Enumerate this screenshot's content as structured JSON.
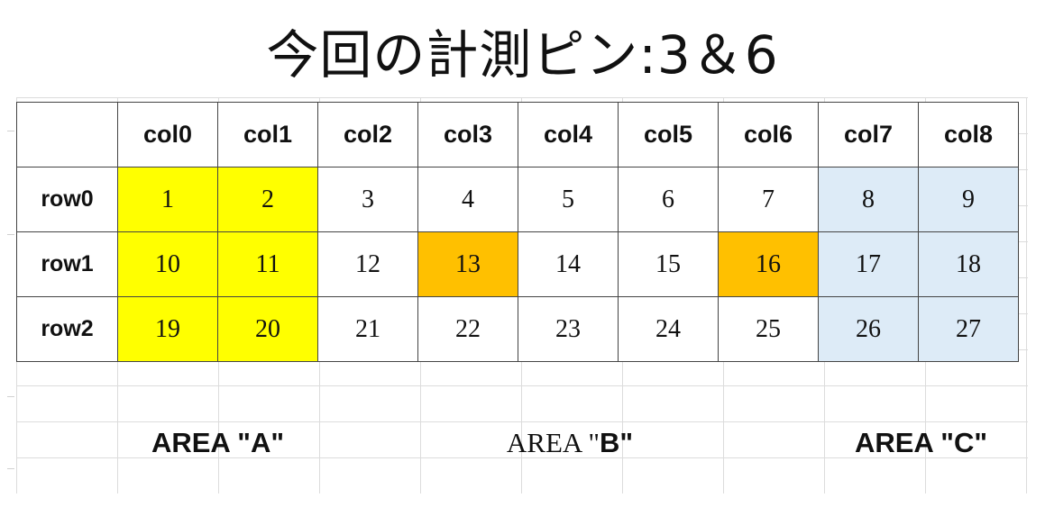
{
  "title": "今回の計測ピン:3＆6",
  "columns": [
    "col0",
    "col1",
    "col2",
    "col3",
    "col4",
    "col5",
    "col6",
    "col7",
    "col8"
  ],
  "rows": [
    {
      "label": "row0",
      "cells": [
        "1",
        "2",
        "3",
        "4",
        "5",
        "6",
        "7",
        "8",
        "9"
      ]
    },
    {
      "label": "row1",
      "cells": [
        "10",
        "11",
        "12",
        "13",
        "14",
        "15",
        "16",
        "17",
        "18"
      ]
    },
    {
      "label": "row2",
      "cells": [
        "19",
        "20",
        "21",
        "22",
        "23",
        "24",
        "25",
        "26",
        "27"
      ]
    }
  ],
  "colors": {
    "area_a": "#ffff00",
    "measured_pin": "#ffc000",
    "area_c": "#ddebf7"
  },
  "areas": {
    "a": "AREA \"A\"",
    "b_prefix": "AREA \"",
    "b_letter": "B",
    "b_suffix": "\"",
    "c": "AREA \"C\""
  }
}
